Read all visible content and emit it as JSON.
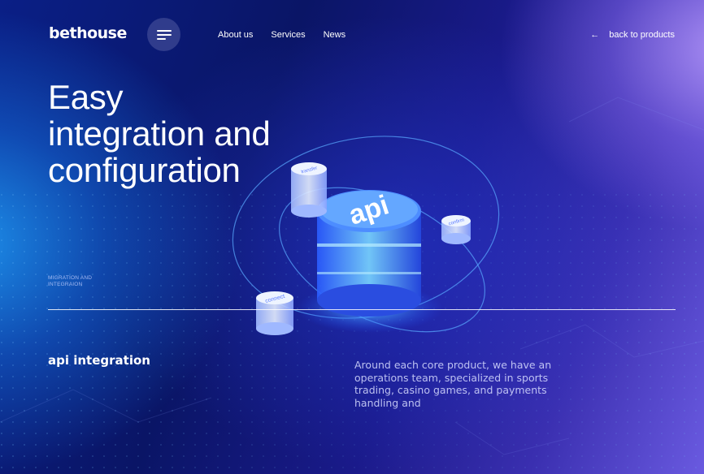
{
  "header": {
    "logo": "bethouse",
    "nav": [
      "About us",
      "Services",
      "News"
    ],
    "back_arrow": "←",
    "back_label": "back to products"
  },
  "hero": {
    "title_lines": [
      "Easy",
      "integration and",
      "configuration"
    ]
  },
  "section": {
    "label_lines": [
      "MIGRATION AND",
      "INTEGRAION"
    ],
    "subtitle": "api integration",
    "description": "Around each core product, we have an operations team, specialized in sports trading, casino games, and payments handling and"
  },
  "illustration": {
    "main_label": "api",
    "node_labels": [
      "connect",
      "transfer",
      "confirm"
    ]
  },
  "colors": {
    "accent": "#3aa0ff",
    "bg_dark": "#0a1566",
    "bg_light": "#8a7af0"
  }
}
